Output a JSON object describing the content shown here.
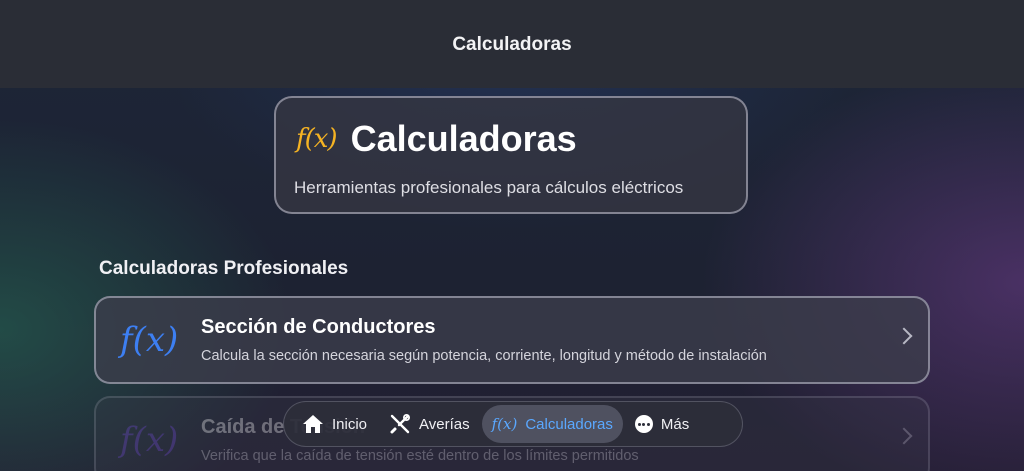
{
  "header": {
    "title": "Calculadoras"
  },
  "hero": {
    "icon": "f(x)",
    "title": "Calculadoras",
    "subtitle": "Herramientas profesionales para cálculos eléctricos"
  },
  "section": {
    "title": "Calculadoras Profesionales"
  },
  "cards": [
    {
      "icon": "f(x)",
      "title": "Sección de Conductores",
      "description": "Calcula la sección necesaria según potencia, corriente, longitud y método de instalación"
    },
    {
      "icon": "f(x)",
      "title": "Caída de Tensión",
      "description": "Verifica que la caída de tensión esté dentro de los límites permitidos"
    }
  ],
  "tabbar": {
    "items": [
      {
        "label": "Inicio",
        "icon": "home-icon"
      },
      {
        "label": "Averías",
        "icon": "tools-icon"
      },
      {
        "label": "Calculadoras",
        "icon": "function-icon",
        "icon_text": "f(x)",
        "active": true
      },
      {
        "label": "Más",
        "icon": "more-icon"
      }
    ]
  },
  "colors": {
    "accent_blue": "#5aa8ff",
    "hero_icon_yellow": "#f5b323",
    "card_icon_blue": "#3d7ff2"
  }
}
